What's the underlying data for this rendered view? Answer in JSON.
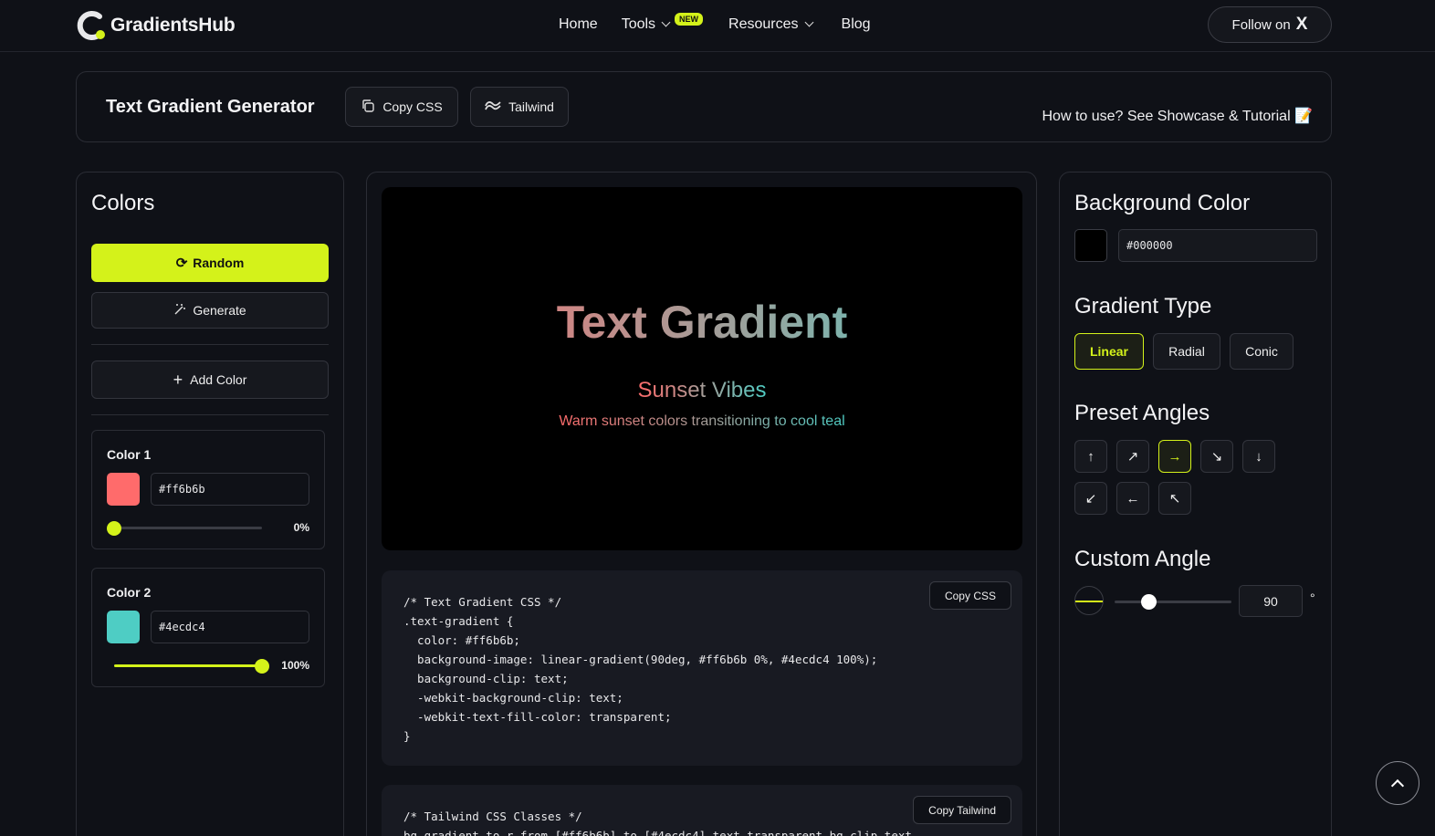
{
  "nav": {
    "brand": "GradientsHub",
    "links": [
      {
        "label": "Home"
      },
      {
        "label": "Tools",
        "badge": "NEW"
      },
      {
        "label": "Resources"
      },
      {
        "label": "Blog"
      }
    ],
    "follow_label": "Follow on",
    "follow_icon": "X"
  },
  "header": {
    "title": "Text Gradient Generator",
    "copy_css_label": "Copy CSS",
    "tailwind_label": "Tailwind",
    "howto": "How to use? See Showcase & Tutorial 📝"
  },
  "colors_panel": {
    "title": "Colors",
    "random_label": "Random",
    "generate_label": "Generate",
    "add_color_label": "Add Color",
    "colors": [
      {
        "label": "Color 1",
        "hex": "#ff6b6b",
        "stop": "0%",
        "stop_fraction": 0.0
      },
      {
        "label": "Color 2",
        "hex": "#4ecdc4",
        "stop": "100%",
        "stop_fraction": 1.0
      }
    ]
  },
  "preview": {
    "title": "Text Gradient",
    "subtitle": "Sunset Vibes",
    "description": "Warm sunset colors transitioning to cool teal"
  },
  "css_code": {
    "copy_label": "Copy CSS",
    "text": "/* Text Gradient CSS */\n.text-gradient {\n  color: #ff6b6b;\n  background-image: linear-gradient(90deg, #ff6b6b 0%, #4ecdc4 100%);\n  background-clip: text;\n  -webkit-background-clip: text;\n  -webkit-text-fill-color: transparent;\n}"
  },
  "tailwind_code": {
    "copy_label": "Copy Tailwind",
    "text": "/* Tailwind CSS Classes */\nbg-gradient-to-r from-[#ff6b6b] to-[#4ecdc4] text-transparent bg-clip-text"
  },
  "settings": {
    "bg_title": "Background Color",
    "bg_hex": "#000000",
    "type_title": "Gradient Type",
    "types": [
      "Linear",
      "Radial",
      "Conic"
    ],
    "active_type": "Linear",
    "preset_title": "Preset Angles",
    "preset_icons": [
      "arrow-up",
      "arrow-up-right",
      "arrow-right",
      "arrow-down-right",
      "arrow-down",
      "arrow-down-left",
      "arrow-left",
      "arrow-up-left"
    ],
    "active_preset": "arrow-right",
    "custom_title": "Custom Angle",
    "angle_value": "90",
    "angle_max": 360,
    "degree_symbol": "°"
  },
  "colors": {
    "accent": "#d4f21a",
    "background": "#0f1117"
  }
}
